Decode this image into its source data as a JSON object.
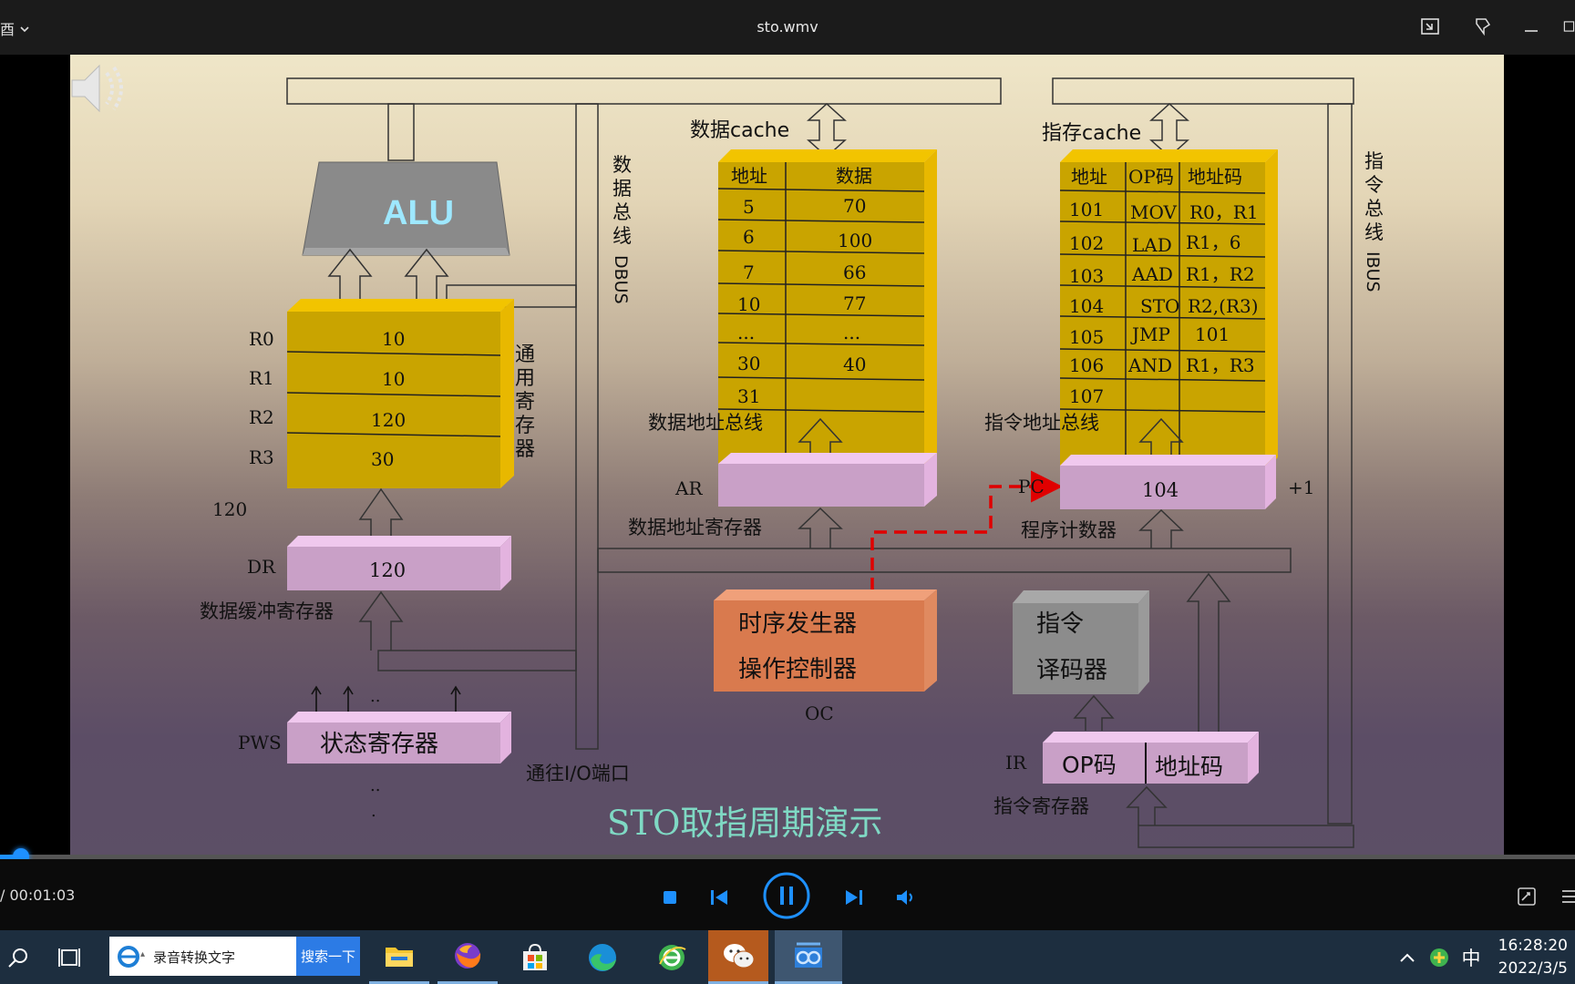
{
  "window": {
    "title": "sto.wmv",
    "left_fragment": "酉"
  },
  "slide": {
    "alu_label": "ALU",
    "dbus_label": "数据总线DBUS",
    "ibus_label": "指令总线IBUS",
    "data_cache_label": "数据cache",
    "instr_cache_label": "指存cache",
    "gpr_label": "通用寄存器",
    "registers": [
      {
        "name": "R0",
        "value": "10"
      },
      {
        "name": "R1",
        "value": "10"
      },
      {
        "name": "R2",
        "value": "120"
      },
      {
        "name": "R3",
        "value": "30"
      }
    ],
    "floating_value": "120",
    "dr_name": "DR",
    "dr_value": "120",
    "dr_caption": "数据缓冲寄存器",
    "pws_name": "PWS",
    "pws_box": "状态寄存器",
    "pws_dots_top": "..",
    "pws_dots_mid": "..",
    "pws_dots_bottom": ".",
    "io_label": "通往I/O端口",
    "data_table": {
      "headers": [
        "地址",
        "数据"
      ],
      "rows": [
        [
          "5",
          "70"
        ],
        [
          "6",
          "100"
        ],
        [
          "7",
          "66"
        ],
        [
          "10",
          "77"
        ],
        [
          "...",
          "..."
        ],
        [
          "30",
          "40"
        ],
        [
          "31",
          ""
        ]
      ]
    },
    "data_addr_bus": "数据地址总线",
    "ar_name": "AR",
    "ar_caption": "数据地址寄存器",
    "instr_table": {
      "headers": [
        "地址",
        "OP码",
        "地址码"
      ],
      "rows": [
        [
          "101",
          "MOV",
          "R0，R1"
        ],
        [
          "102",
          "LAD",
          "R1，6"
        ],
        [
          "103",
          "AAD",
          "R1，R2"
        ],
        [
          "104",
          "STO",
          "R2,(R3)"
        ],
        [
          "105",
          "JMP",
          "101"
        ],
        [
          "106",
          "AND",
          "R1，R3"
        ],
        [
          "107",
          "",
          ""
        ]
      ]
    },
    "instr_addr_bus": "指令地址总线",
    "pc_name": "PC",
    "pc_value": "104",
    "pc_plus": "+1",
    "pc_caption": "程序计数器",
    "timing_line1": "时序发生器",
    "timing_line2": "操作控制器",
    "oc_label": "OC",
    "decoder_line1": "指令",
    "decoder_line2": "译码器",
    "ir_name": "IR",
    "ir_op": "OP码",
    "ir_addr": "地址码",
    "ir_caption": "指令寄存器",
    "bottom_title": "STO取指周期演示"
  },
  "player": {
    "time": "/ 00:01:03",
    "progress_fraction": 0.012
  },
  "taskbar": {
    "search_text": "录音转换文字",
    "search_button": "搜索一下",
    "ime": "中",
    "time": "16:28:20",
    "date": "2022/3/5"
  },
  "colors": {
    "accent": "#1e90ff",
    "register_gold": "#c9a400",
    "pink_box": "#d9a8d4",
    "orange_box": "#d97a4e",
    "grey_box": "#8c8c8c",
    "bottom_title": "#7fd9c4",
    "red_arrow": "#e00000"
  },
  "icons": [
    "speaker-icon",
    "snap-icon",
    "pin-icon",
    "minimize-icon",
    "stop-icon",
    "prev-icon",
    "pause-icon",
    "next-icon",
    "volume-icon",
    "settings-icon",
    "playlist-icon",
    "search-icon",
    "taskview-icon",
    "ie-icon",
    "explorer-icon",
    "firefox-icon",
    "store-icon",
    "edge-icon",
    "ie2-icon",
    "wechat-icon",
    "player-icon",
    "tray-chevron-icon",
    "tray-app-icon"
  ]
}
